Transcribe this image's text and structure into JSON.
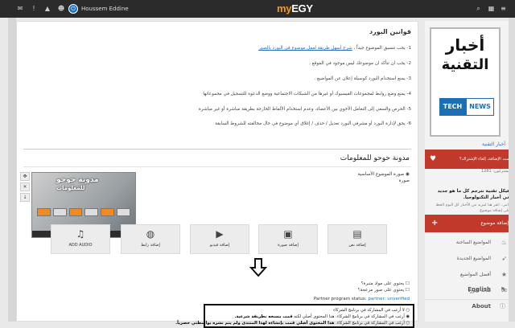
{
  "topbar": {
    "user_name": "Houssem Eddine",
    "logo_prefix": "my",
    "logo_main": "EGY",
    "icons": [
      "mail-icon",
      "bell-icon",
      "warning-icon",
      "users-icon"
    ]
  },
  "main": {
    "section_title": "قوانين البورد",
    "rules": [
      {
        "text": "1- يجب تنسيق الموضوع جيداً ، ",
        "link": "شرح أسهل طريقة لعمل موضوع في البورد بالصور"
      },
      {
        "text": "2- يجب ان تتأكد ان موضوعك ليس موجود في الموقع .",
        "link": ""
      },
      {
        "text": "3- يمنع استخدام البورد كوسيلة إعلان عن المواضيع .",
        "link": ""
      },
      {
        "text": "4- يمنع وضع روابط لمجموعات الفيسبوك أو غيرها من الشبكات الاجتماعية ووضع الدعوة للتسجيل في مجموعاتها",
        "link": ""
      },
      {
        "text": "5- الحرص والسعي إلى التعامل الأخوي بين الأعضاء، وعدم استخدام الألفاظ الخارجة بطريقة مباشرة أو غير مباشرة",
        "link": ""
      },
      {
        "text": "6- يحق لإدارة البورد أو مشرفي البورد تعديل / حذف / إغلاق أي موضوع في حال مخالفته للشروط السابقة",
        "link": ""
      }
    ],
    "blog_title": "مدونة حوحو للمعلومات",
    "image_option_label": "صورة الموضوع الأساسية",
    "image_option_sub": "صورة",
    "thumb_title": "مدونة حوحو",
    "thumb_sub": "للمعلومات",
    "buttons": [
      {
        "label": "إضافة نص",
        "icon": "text-file-icon"
      },
      {
        "label": "إضافة صورة",
        "icon": "image-icon"
      },
      {
        "label": "إضافة فيديو",
        "icon": "video-icon"
      },
      {
        "label": "إضافة رابط",
        "icon": "globe-icon"
      },
      {
        "label": "ADD AUDIO",
        "icon": "music-icon"
      }
    ],
    "check1": "يحتوي على مواد متبرة؟",
    "check2": "يحتوي على صور مزعجة؟",
    "partner_label": "Partner program status:",
    "partner_value": "partner: unverified",
    "radio1": "لا أرغب في المشاركة في برنامج الشركاء",
    "radio2_normal": "أرغب في المشاركة في برنامج الشركاء. هذا المحتوى أصلي لكنه ",
    "radio2_bold": "قمت بنسخه بطريقة شرعية.",
    "radio3_normal": "أرغب في المشاركة في برنامج الشركاء. ",
    "radio3_bold": "هذا المحتوى أصلي قمت بإنشاءه لهذا المنتدى ولم يتم نشره بواسطتي حصرياً."
  },
  "sidebar": {
    "banner_line1": "أخبار",
    "banner_line2": "التقنية",
    "banner_tech": "TECH",
    "banner_news": "NEWS",
    "link": "أخبار التقنية",
    "alert": "تمت الإضافة، إلغاء الإشتراك؟",
    "subscribers": "مشتركون: 1281",
    "post_title": "هيكل تقنية نترجم كل ما هو جديد في أخبار التكنولوجيا.",
    "post_meta": "دامر.. انقر هنا لمزيد من الأخبار كل اليوم الخط على إضافة موضوع",
    "add_topic": "إضافة موضوع",
    "nav": [
      {
        "label": "المواضيع الساخنة",
        "icon": "fire-icon"
      },
      {
        "label": "المواضيع الجديدة",
        "icon": "rocket-icon"
      },
      {
        "label": "أفضل المواضيع",
        "icon": "star-icon"
      },
      {
        "label": "شات البورد",
        "icon": "chat-icon"
      }
    ],
    "lang": "English",
    "about": "About"
  }
}
